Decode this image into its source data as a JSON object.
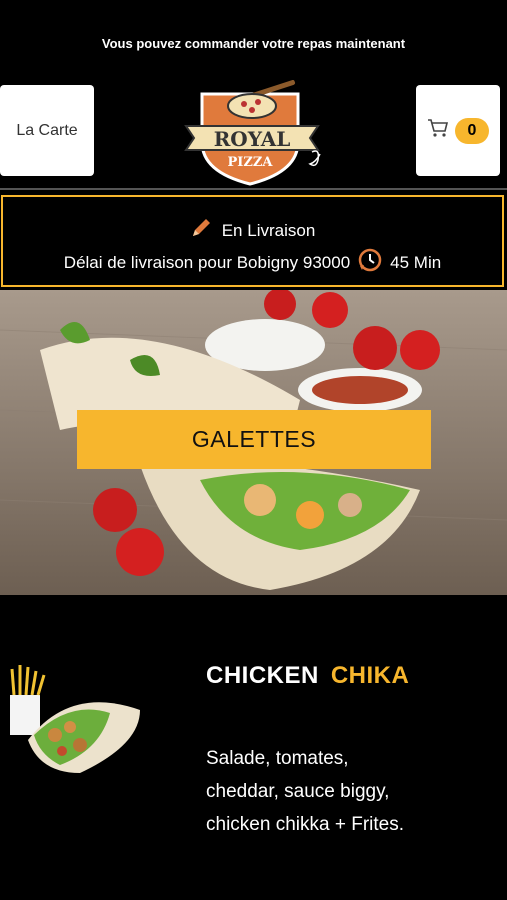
{
  "header": {
    "notice": "Vous pouvez commander votre repas maintenant",
    "menu_label": "La Carte",
    "cart_count": "0",
    "logo_text_top": "ROYAL",
    "logo_text_bottom": "PIZZA"
  },
  "delivery": {
    "mode": "En Livraison",
    "delay_text": "Délai de livraison pour Bobigny 93000",
    "delay_value": "45 Min"
  },
  "category": {
    "title": "GALETTES"
  },
  "product": {
    "name_part1": "CHICKEN",
    "name_part2": "CHIKA",
    "description": "Salade, tomates, cheddar, sauce biggy, chicken chikka  + Frites."
  },
  "colors": {
    "accent": "#f7b62d",
    "background": "#000000",
    "logo_orange": "#e07a3c"
  },
  "icons": [
    "pencil-icon",
    "cart-icon",
    "clock-icon"
  ]
}
